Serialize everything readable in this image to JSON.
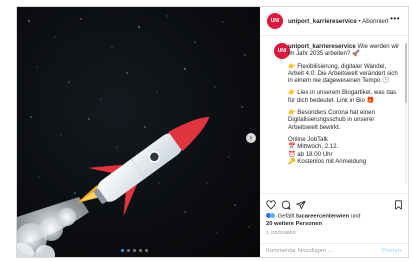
{
  "post": {
    "account": "uniport_karriereservice",
    "follow_state": "Abonniert",
    "more": "•••",
    "avatar_text": "UNI"
  },
  "caption": {
    "account": "uniport_karriereservice",
    "intro": "Wie werden wir im Jahr 2035 arbeiten? 🚀",
    "p1": "👉 Flexibilisierung, digitaler Wandel, Arbeit 4.0: Die Arbeitswelt verändert sich in einem nie dagewesenen Tempo 🕒",
    "p2": "👉 Lies in unserem Blogartikel, was das für dich bedeutet. Link in Bio 🎁",
    "p3": "👉 Besonders Corona hat einen Digitalisierungsschub in unserer Arbeitswelt bewirkt.",
    "p4_l1": "Online JobTalk",
    "p4_l2": "📅 Mittwoch, 2.12.",
    "p4_l3": "⏰ ab 18.00 Uhr",
    "p4_l4": "🔑 Kostenlos mit Anmeldung"
  },
  "likes": {
    "prefix": "Gefällt",
    "user": "tucareercenterwien",
    "and": "und",
    "others": "20 weitere Personen"
  },
  "timestamp": "1. Dezember",
  "comment": {
    "placeholder": "Kommentar hinzufügen ...",
    "post_label": "Posten"
  },
  "carousel": {
    "slide_count": 5,
    "active_index": 0,
    "next_icon": "chevron-right-icon"
  },
  "colors": {
    "brand": "#d71a3d",
    "link_blue": "#3897f0",
    "post_btn_disabled": "#b2dffc"
  }
}
